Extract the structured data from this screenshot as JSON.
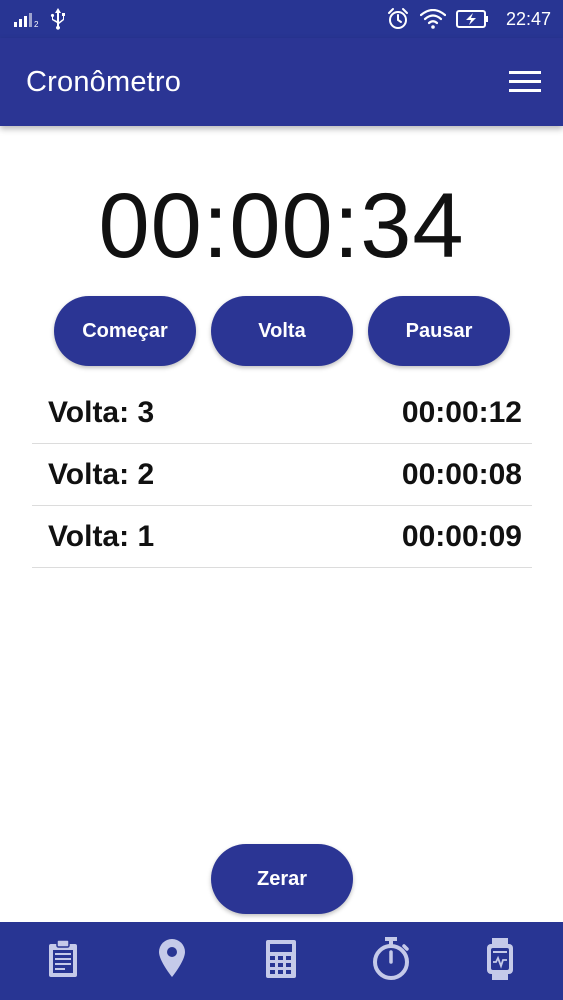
{
  "status_bar": {
    "signal_sub": "2",
    "time": "22:47"
  },
  "app_bar": {
    "title": "Cronômetro",
    "menu_icon": "hamburger-menu-icon"
  },
  "timer": {
    "display": "00:00:34"
  },
  "buttons": {
    "start": "Começar",
    "lap": "Volta",
    "pause": "Pausar",
    "reset": "Zerar"
  },
  "laps": [
    {
      "label": "Volta: 3",
      "time": "00:00:12"
    },
    {
      "label": "Volta: 2",
      "time": "00:00:08"
    },
    {
      "label": "Volta: 1",
      "time": "00:00:09"
    }
  ],
  "bottom_nav": [
    {
      "icon": "clipboard-icon"
    },
    {
      "icon": "location-pin-icon"
    },
    {
      "icon": "calculator-icon"
    },
    {
      "icon": "stopwatch-icon"
    },
    {
      "icon": "smartwatch-icon"
    }
  ],
  "colors": {
    "primary": "#2b3594",
    "status_bar": "#283593",
    "icon_light": "#c5cae9",
    "text": "#111111"
  }
}
